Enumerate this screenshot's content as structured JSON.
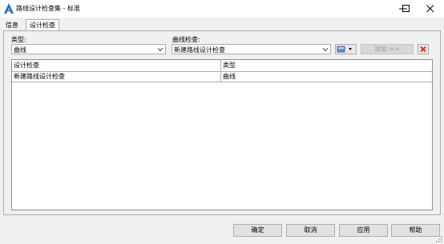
{
  "window": {
    "title": "路线设计检查集 - 标准"
  },
  "tabs": [
    {
      "label": "信息"
    },
    {
      "label": "设计检查"
    }
  ],
  "type_field": {
    "label": "类型:",
    "value": "曲线"
  },
  "curve_check_field": {
    "label": "曲线检查:",
    "value": "新建路线设计检查"
  },
  "add_button": {
    "label": "添加 >>"
  },
  "table": {
    "columns": [
      "设计检查",
      "类型"
    ],
    "rows": [
      [
        "新建路线设计检查",
        "曲线"
      ]
    ]
  },
  "footer": {
    "ok": "确定",
    "cancel": "取消",
    "apply": "应用",
    "help": "帮助"
  },
  "icons": {
    "app": "civil3d-logo-icon",
    "minimize": "minimize-icon",
    "maximize": "maximize-icon",
    "close": "close-icon",
    "check_editor": "check-editor-icon",
    "delete": "delete-x-icon"
  },
  "colors": {
    "delete_icon": "#d9302c",
    "app_icon": "#1f6fb2"
  }
}
